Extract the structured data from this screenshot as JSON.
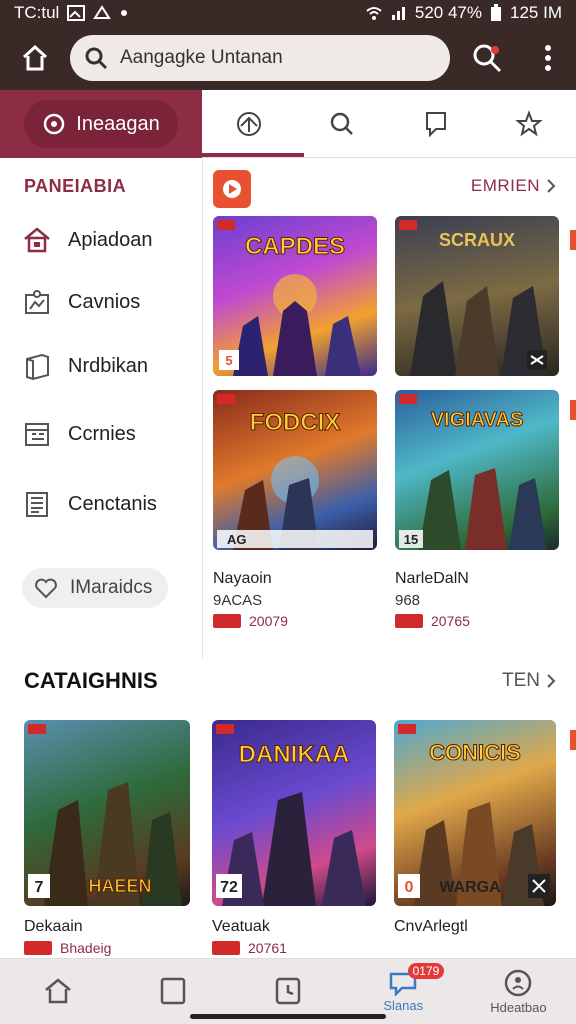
{
  "status": {
    "left_text": "TC:tul",
    "right_text": "520 47%",
    "time": "125 IM"
  },
  "search": {
    "value": "Aangagke Untanan"
  },
  "tabs": {
    "active_label": "Ineaagan",
    "icons": [
      "tag-icon",
      "search-icon",
      "bookmark-icon",
      "star-icon"
    ]
  },
  "sidebar": {
    "title": "PANEIABIA",
    "items": [
      {
        "label": "Apiadoan",
        "icon": "home-icon"
      },
      {
        "label": "Cavnios",
        "icon": "puzzle-icon"
      },
      {
        "label": "Nrdbikan",
        "icon": "book-icon"
      },
      {
        "label": "Ccrnies",
        "icon": "calendar-icon"
      },
      {
        "label": "Cenctanis",
        "icon": "list-icon"
      }
    ],
    "pill_label": "IMaraidcs"
  },
  "featured": {
    "more_label": "EMRIEN",
    "games": [
      {
        "title_art": "CAPDES",
        "corner": "5",
        "name": "",
        "sub": "",
        "rank": ""
      },
      {
        "title_art": "SCRAUX",
        "corner": "",
        "name": "",
        "sub": "",
        "rank": ""
      },
      {
        "title_art": "FODCIX",
        "corner": "AG",
        "name": "Nayaoin",
        "sub": "9ACAS",
        "rank": "20079"
      },
      {
        "title_art": "VIGIAVAS",
        "corner": "15",
        "name": "NarleDalN",
        "sub": "968",
        "rank": "20765"
      }
    ]
  },
  "section2": {
    "title": "CATAIGHNIS",
    "more_label": "TEN",
    "games": [
      {
        "title_art": "HAEEN",
        "corner": "7",
        "name": "Dekaain",
        "rank": "Bhadeig"
      },
      {
        "title_art": "DANIKAA",
        "corner": "72",
        "name": "Veatuak",
        "rank": "20761"
      },
      {
        "title_art": "CONICIS",
        "corner": "0",
        "name": "CnvArlegtl",
        "rank": "WARGA"
      }
    ]
  },
  "bottomnav": {
    "items": [
      {
        "label": "",
        "icon": "home-icon"
      },
      {
        "label": "",
        "icon": "tablet-icon"
      },
      {
        "label": "",
        "icon": "clock-icon"
      },
      {
        "label": "Slanas",
        "icon": "chat-icon"
      },
      {
        "label": "Hdeatbao",
        "icon": "profile-icon"
      }
    ],
    "badge": "0179"
  },
  "colors": {
    "accent": "#8d2c45",
    "header": "#3a2a27",
    "brand": "#e8512f"
  }
}
